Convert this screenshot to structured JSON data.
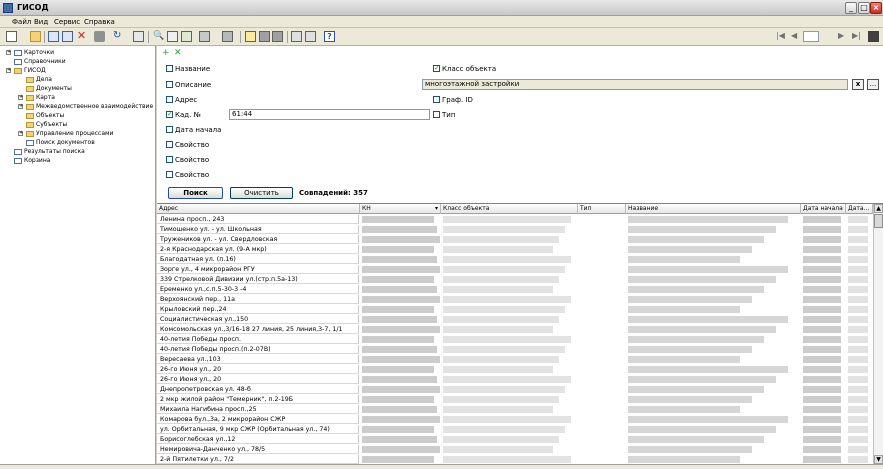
{
  "window": {
    "title": "ГИСОД"
  },
  "menu": [
    "Файл",
    "Вид",
    "Сервис",
    "Справка"
  ],
  "tree": [
    {
      "label": "Карточки",
      "level": 0,
      "icon": "cards-icon"
    },
    {
      "label": "Справочники",
      "level": 0,
      "icon": "reference-icon"
    },
    {
      "label": "ГИСОД",
      "level": 0,
      "icon": "folder-icon"
    },
    {
      "label": "Дела",
      "level": 1,
      "icon": "folder-icon"
    },
    {
      "label": "Документы",
      "level": 1,
      "icon": "folder-icon"
    },
    {
      "label": "Карта",
      "level": 1,
      "icon": "folder-icon"
    },
    {
      "label": "Межведомственное взаимодействие",
      "level": 1,
      "icon": "folder-icon"
    },
    {
      "label": "Объекты",
      "level": 1,
      "icon": "folder-icon"
    },
    {
      "label": "Субъекты",
      "level": 1,
      "icon": "folder-icon"
    },
    {
      "label": "Управление процессами",
      "level": 1,
      "icon": "folder-icon"
    },
    {
      "label": "Поиск документов",
      "level": 1,
      "icon": "search-doc-icon"
    },
    {
      "label": "Результаты поиска",
      "level": 0,
      "icon": "search-results-icon"
    },
    {
      "label": "Корзина",
      "level": 0,
      "icon": "basket-icon"
    }
  ],
  "filter": {
    "left": [
      {
        "label": "Название",
        "checked": false
      },
      {
        "label": "Описание",
        "checked": false
      },
      {
        "label": "Адрес",
        "checked": false
      },
      {
        "label": "Кад. №",
        "checked": true,
        "value": "61:44"
      },
      {
        "label": "Дата начала",
        "checked": false
      },
      {
        "label": "Свойство",
        "checked": false
      },
      {
        "label": "Свойство",
        "checked": false
      },
      {
        "label": "Свойство",
        "checked": false
      }
    ],
    "right": [
      {
        "label": "Класс объекта",
        "checked": true,
        "value": "многоэтажной застройки"
      },
      {
        "label": "Граф. ID",
        "checked": false
      },
      {
        "label": "Тип",
        "checked": false
      }
    ],
    "search_label": "Поиск",
    "clear_label": "Очистить",
    "matches": "Совпадений: 357",
    "clear_x": "x",
    "ellipsis": "..."
  },
  "grid": {
    "columns": [
      "Адрес",
      "КН",
      "Класс объекта",
      "Тип",
      "Название",
      "Дата начала",
      "Дата..."
    ],
    "rows": [
      "Ленина просп., 243",
      "Тимошенко ул. - ул. Школьная",
      "Тружеников ул. - ул. Свердловская",
      "2-я Краснодарская ул. (9-А мкр)",
      "Благодатная ул. (п.16)",
      "Зорге ул., 4 микрорайон РГУ",
      "339 Стрелковой Дивизии ул.(стр.п.5а-13)",
      "Еременко ул.,с.п.5-30-3 -4",
      "Верхоянский пер., 11а",
      "Крыловский пер.,24",
      "Социалистическая ул.,150",
      "Комсомольская ул.,3/16-18 27 линия, 25 линия,3-7, 1/1",
      "40-летия Победы просп.",
      "40-летия Победы просп.(п.2-07В)",
      "Вересаева ул.,103",
      "26-го Июня ул., 20",
      "26-го Июня ул., 20",
      "Днепропетровская ул. 48-б",
      "2 мкр жилой район \"Темерник\", п.2-19Б",
      "Михаила Нагибина просп.,25",
      "Комарова бул.,3а, 2 микрорайон СЖР",
      "ул. Орбитальная, 9 мкр СЖР (Орбитальная ул., 74)",
      "Борисоглебская ул.,12",
      "Немировича-Данченко ул., 78/5",
      "2-й Пятилетки ул., 7/2"
    ]
  },
  "colors": {
    "accent": "#21a121",
    "border": "#7f9db9",
    "panel": "#ece9d8"
  }
}
